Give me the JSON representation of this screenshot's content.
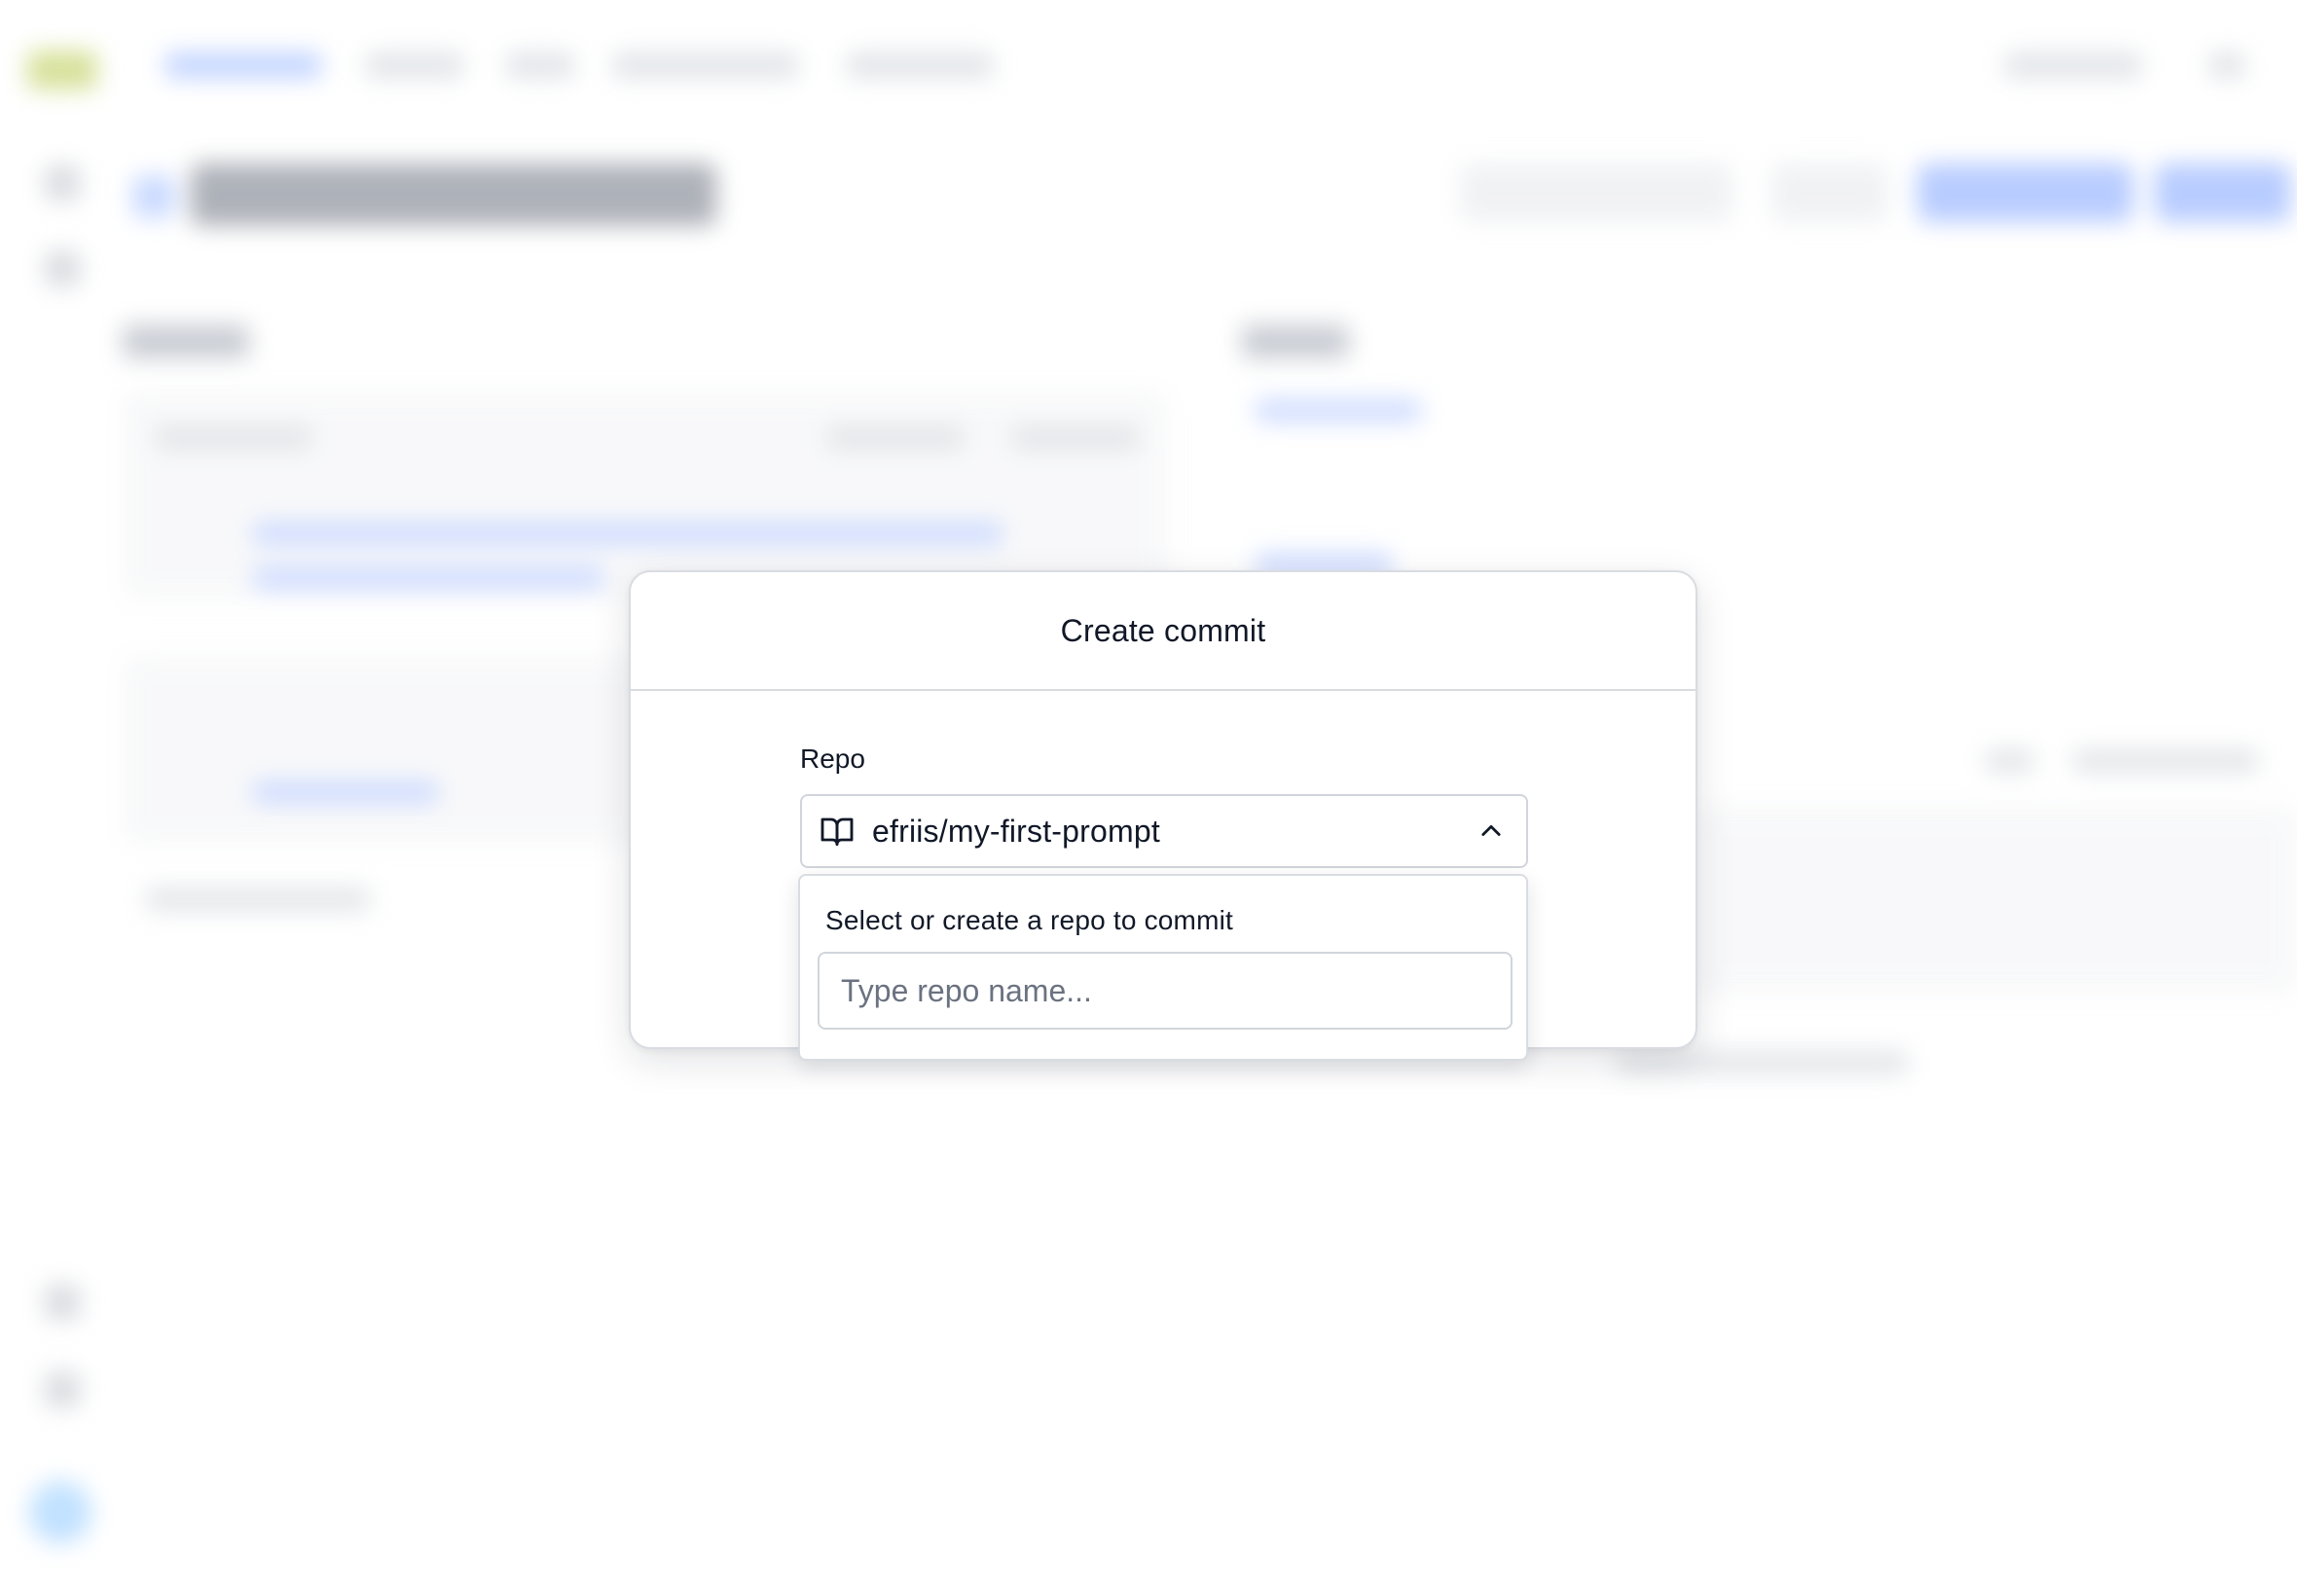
{
  "modal": {
    "title": "Create commit",
    "repo_label": "Repo",
    "selected_repo": "efriis/my-first-prompt"
  },
  "repo_dropdown": {
    "heading": "Select or create a repo to commit",
    "search_placeholder": "Type repo name..."
  },
  "icons": {
    "repo": "book-open-icon",
    "toggle": "chevron-up-icon"
  },
  "colors": {
    "overlay_bg": "#ffffff",
    "border": "#d9dce1",
    "text": "#111827",
    "placeholder": "#6b7280",
    "brand_blue": "#7ea3ff"
  }
}
